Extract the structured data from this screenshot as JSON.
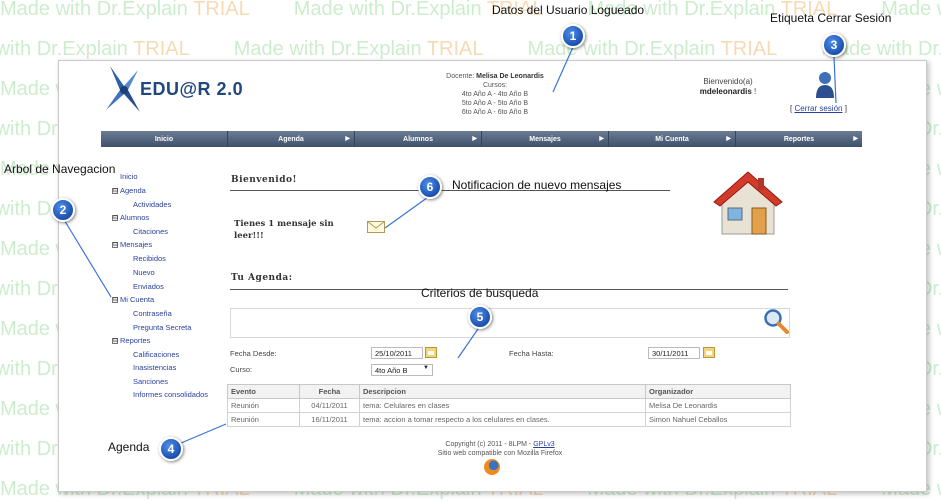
{
  "watermark": {
    "made_with": "Made with Dr.Explain",
    "trial": "TRIAL"
  },
  "header": {
    "logo_text": "EDU@R 2.0",
    "docente_label": "Docente:",
    "docente_name": "Melisa De Leonardis",
    "cursos_label": "Cursos:",
    "cursos": [
      "4to Año A - 4to Año B",
      "5to Año A - 5to Año B",
      "6to Año A - 6to Año B"
    ],
    "welcome_label": "Bienvenido(a)",
    "username": "mdeleonardis",
    "welcome_suffix": "!",
    "logout_open": "[",
    "logout_label": "Cerrar sesión",
    "logout_close": "]"
  },
  "nav": {
    "items": [
      {
        "label": "Inicio",
        "arrow": ""
      },
      {
        "label": "Agenda",
        "arrow": "▶"
      },
      {
        "label": "Alumnos",
        "arrow": "▶"
      },
      {
        "label": "Mensajes",
        "arrow": "▶"
      },
      {
        "label": "Mi Cuenta",
        "arrow": "▶"
      },
      {
        "label": "Reportes",
        "arrow": "▶"
      }
    ]
  },
  "tree": {
    "toggle": "⊟",
    "items": [
      {
        "label": "Inicio"
      },
      {
        "label": "Agenda"
      },
      {
        "label": "Actividades"
      },
      {
        "label": "Alumnos"
      },
      {
        "label": "Citaciones"
      },
      {
        "label": "Mensajes"
      },
      {
        "label": "Recibidos"
      },
      {
        "label": "Nuevo"
      },
      {
        "label": "Enviados"
      },
      {
        "label": "Mi Cuenta"
      },
      {
        "label": "Contraseña"
      },
      {
        "label": "Pregunta Secreta"
      },
      {
        "label": "Reportes"
      },
      {
        "label": "Calificaciones"
      },
      {
        "label": "Inasistencias"
      },
      {
        "label": "Sanciones"
      },
      {
        "label": "Informes consolidados"
      }
    ]
  },
  "main": {
    "welcome_title": "Bienvenido!",
    "message_text": "Tienes 1 mensaje sin leer!!!",
    "agenda_title": "Tu Agenda:",
    "fecha_desde_label": "Fecha Desde:",
    "fecha_desde_value": "25/10/2011",
    "fecha_hasta_label": "Fecha Hasta:",
    "fecha_hasta_value": "30/11/2011",
    "curso_label": "Curso:",
    "curso_value": "4to Año B",
    "curso_dropdown_glyph": "▼"
  },
  "table": {
    "columns": [
      "Evento",
      "Fecha",
      "Descripcion",
      "Organizador"
    ],
    "rows": [
      [
        "Reunión",
        "04/11/2011",
        "tema: Celulares en clases",
        "Melisa De Leonardis"
      ],
      [
        "Reunión",
        "16/11/2011",
        "tema: accion a tomar respecto a los celulares en clases.",
        "Simon Nahuel Ceballos"
      ]
    ]
  },
  "footer": {
    "copyright": "Copyright (c) 2011 - 8LPM -",
    "license": "GPLv3",
    "compat": "Sitio web compatible con Mozilla Firefox"
  },
  "callouts": [
    {
      "number": "1",
      "label": "Datos del Usuario Logueado"
    },
    {
      "number": "2",
      "label": "Arbol de Navegacion"
    },
    {
      "number": "3",
      "label": "Etiqueta Cerrar Sesión"
    },
    {
      "number": "4",
      "label": "Agenda"
    },
    {
      "number": "5",
      "label": "Criterios de busqueda"
    },
    {
      "number": "6",
      "label": "Notificacion de nuevo mensajes"
    }
  ]
}
